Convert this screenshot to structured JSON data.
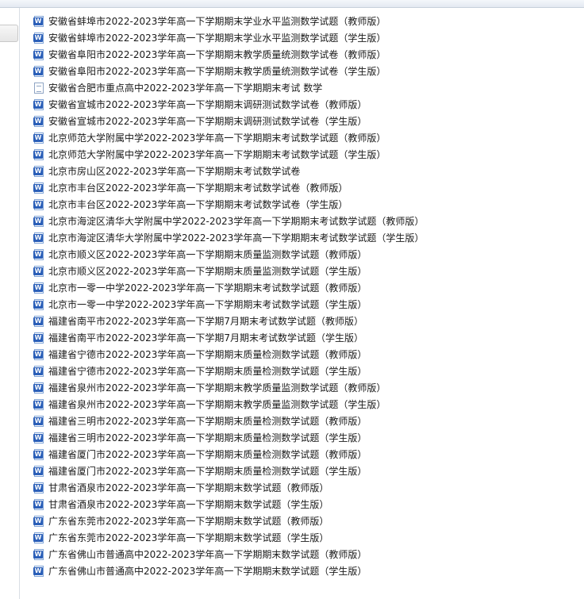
{
  "files": [
    {
      "name": "安徽省蚌埠市2022-2023学年高一下学期期末学业水平监测数学试题（教师版）",
      "icon": "word-doc-icon"
    },
    {
      "name": "安徽省蚌埠市2022-2023学年高一下学期期末学业水平监测数学试题（学生版）",
      "icon": "word-doc-icon"
    },
    {
      "name": "安徽省阜阳市2022-2023学年高一下学期期末教学质量统测数学试卷（教师版）",
      "icon": "word-doc-icon"
    },
    {
      "name": "安徽省阜阳市2022-2023学年高一下学期期末教学质量统测数学试卷（学生版）",
      "icon": "word-doc-icon"
    },
    {
      "name": "安徽省合肥市重点高中2022-2023学年高一下学期期末考试 数学",
      "icon": "generic-doc-icon"
    },
    {
      "name": "安徽省宣城市2022-2023学年高一下学期期末调研测试数学试卷（教师版）",
      "icon": "word-doc-icon"
    },
    {
      "name": "安徽省宣城市2022-2023学年高一下学期期末调研测试数学试卷（学生版）",
      "icon": "word-doc-icon"
    },
    {
      "name": "北京师范大学附属中学2022-2023学年高一下学期期末考试数学试题（教师版）",
      "icon": "word-doc-icon"
    },
    {
      "name": "北京师范大学附属中学2022-2023学年高一下学期期末考试数学试题（学生版）",
      "icon": "word-doc-icon"
    },
    {
      "name": "北京市房山区2022-2023学年高一下学期期末考试数学试卷",
      "icon": "word-doc-icon"
    },
    {
      "name": "北京市丰台区2022-2023学年高一下学期期末考试数学试卷（教师版）",
      "icon": "word-doc-icon"
    },
    {
      "name": "北京市丰台区2022-2023学年高一下学期期末考试数学试卷（学生版）",
      "icon": "word-doc-icon"
    },
    {
      "name": "北京市海淀区清华大学附属中学2022-2023学年高一下学期期末考试数学试题（教师版）",
      "icon": "word-doc-icon"
    },
    {
      "name": "北京市海淀区清华大学附属中学2022-2023学年高一下学期期末考试数学试题（学生版）",
      "icon": "word-doc-icon"
    },
    {
      "name": "北京市顺义区2022-2023学年高一下学期期末质量监测数学试题（教师版）",
      "icon": "word-doc-icon"
    },
    {
      "name": "北京市顺义区2022-2023学年高一下学期期末质量监测数学试题（学生版）",
      "icon": "word-doc-icon"
    },
    {
      "name": "北京市一零一中学2022-2023学年高一下学期期末考试数学试题（教师版）",
      "icon": "word-doc-icon"
    },
    {
      "name": "北京市一零一中学2022-2023学年高一下学期期末考试数学试题（学生版）",
      "icon": "word-doc-icon"
    },
    {
      "name": "福建省南平市2022-2023学年高一下学期7月期末考试数学试题（教师版）",
      "icon": "word-doc-icon"
    },
    {
      "name": "福建省南平市2022-2023学年高一下学期7月期末考试数学试题（学生版）",
      "icon": "word-doc-icon"
    },
    {
      "name": "福建省宁德市2022-2023学年高一下学期期末质量检测数学试题（教师版）",
      "icon": "word-doc-icon"
    },
    {
      "name": "福建省宁德市2022-2023学年高一下学期期末质量检测数学试题（学生版）",
      "icon": "word-doc-icon"
    },
    {
      "name": "福建省泉州市2022-2023学年高一下学期期末教学质量监测数学试题（教师版）",
      "icon": "word-doc-icon"
    },
    {
      "name": "福建省泉州市2022-2023学年高一下学期期末教学质量监测数学试题（学生版）",
      "icon": "word-doc-icon"
    },
    {
      "name": "福建省三明市2022-2023学年高一下学期期末质量检测数学试题（教师版）",
      "icon": "word-doc-icon"
    },
    {
      "name": "福建省三明市2022-2023学年高一下学期期末质量检测数学试题（学生版）",
      "icon": "word-doc-icon"
    },
    {
      "name": "福建省厦门市2022-2023学年高一下学期期末质量检测数学试题（教师版）",
      "icon": "word-doc-icon"
    },
    {
      "name": "福建省厦门市2022-2023学年高一下学期期末质量检测数学试题（学生版）",
      "icon": "word-doc-icon"
    },
    {
      "name": "甘肃省酒泉市2022-2023学年高一下学期期末数学试题（教师版）",
      "icon": "word-doc-icon"
    },
    {
      "name": "甘肃省酒泉市2022-2023学年高一下学期期末数学试题（学生版）",
      "icon": "word-doc-icon"
    },
    {
      "name": "广东省东莞市2022-2023学年高一下学期期末数学试题（教师版）",
      "icon": "word-doc-icon"
    },
    {
      "name": "广东省东莞市2022-2023学年高一下学期期末数学试题（学生版）",
      "icon": "word-doc-icon"
    },
    {
      "name": "广东省佛山市普通高中2022-2023学年高一下学期期末数学试题（教师版）",
      "icon": "word-doc-icon"
    },
    {
      "name": "广东省佛山市普通高中2022-2023学年高一下学期期末数学试题（学生版）",
      "icon": "word-doc-icon"
    }
  ],
  "colors": {
    "word_icon": "#2b5fb8",
    "text": "#1a1a1a",
    "background": "#ffffff"
  }
}
